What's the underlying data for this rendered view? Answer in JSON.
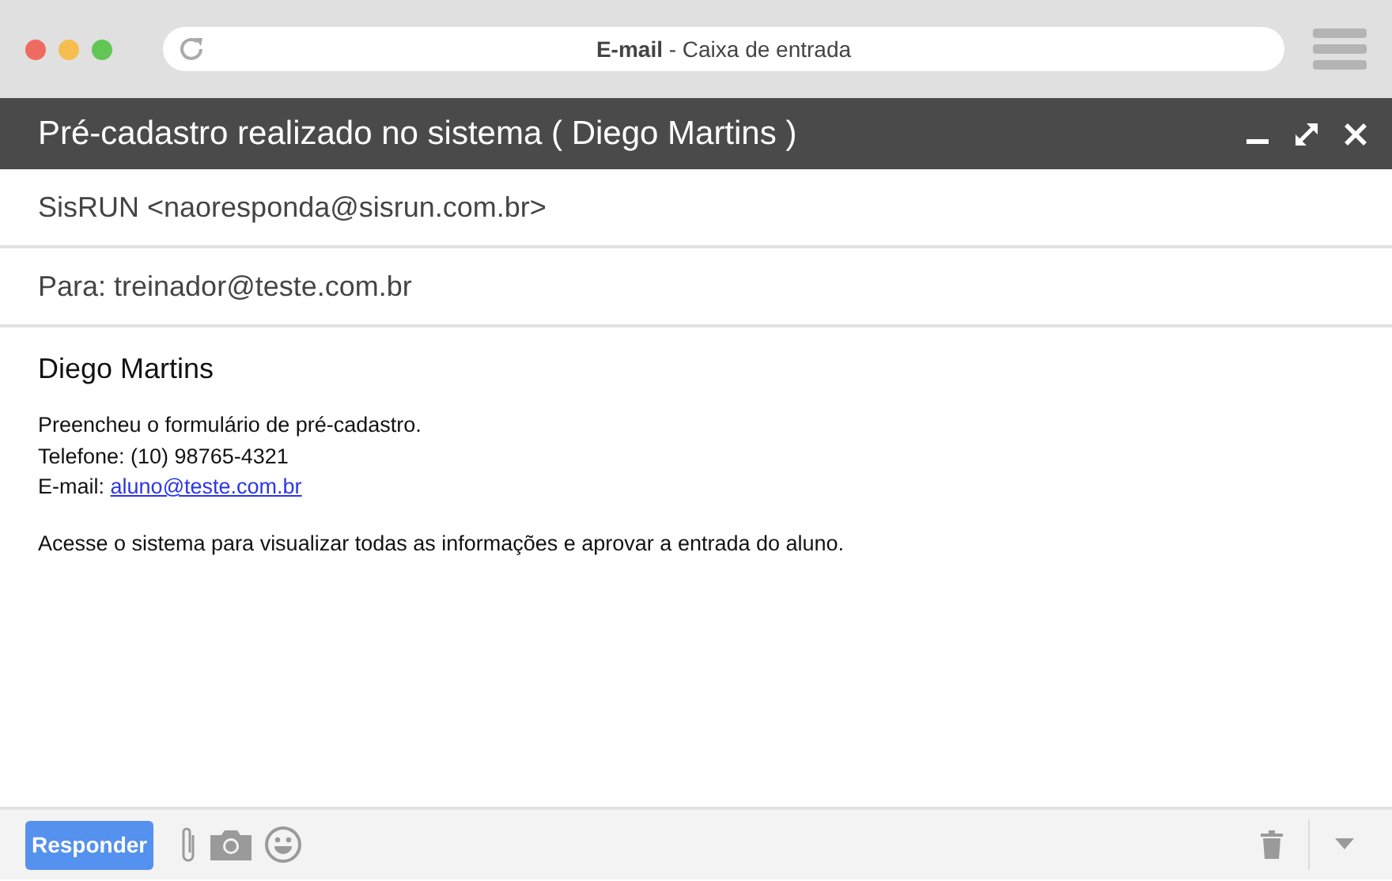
{
  "browser": {
    "address": "**E-mail** - Caixa de entrada"
  },
  "email": {
    "subject": "Pré-cadastro realizado no sistema ( Diego Martins )",
    "from": "SisRUN <naoresponda@sisrun.com.br>",
    "to": "Para: treinador@teste.com.br",
    "greeting": "Diego Martins",
    "lines": [
      {
        "kind": "text",
        "text": "Preencheu o formulário de pré-cadastro."
      },
      {
        "kind": "text",
        "text": "Telefone: (10) 98765-4321"
      },
      {
        "kind": "link",
        "text": "E-mail:",
        "link": "aluno@teste.com.br"
      }
    ],
    "closing": "Acesse o sistema para visualizar todas as informações e aprovar a entrada do aluno."
  },
  "toolbar": {
    "reply_button": "Responder"
  }
}
